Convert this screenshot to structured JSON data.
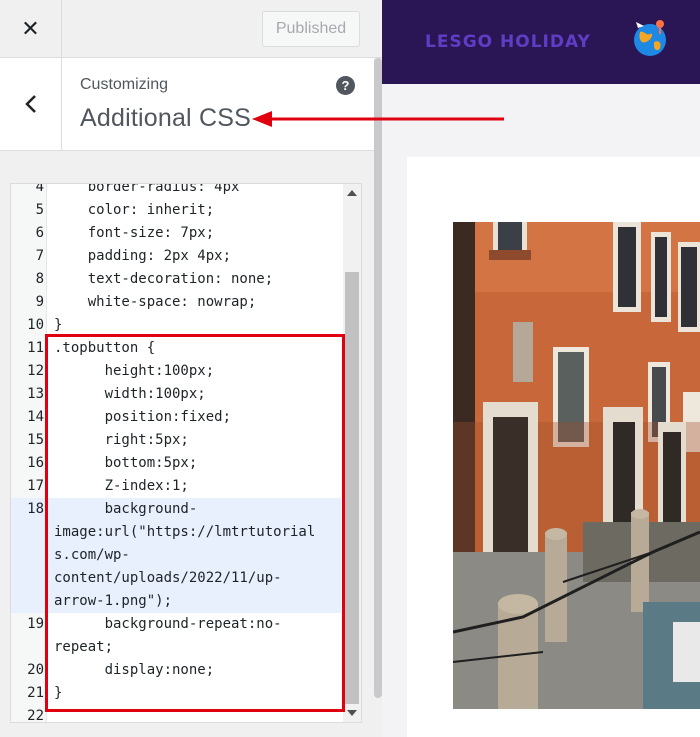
{
  "topbar": {
    "close_glyph": "✕",
    "publish_label": "Published"
  },
  "section": {
    "customizing_label": "Customizing",
    "title": "Additional CSS",
    "help_glyph": "?"
  },
  "editor": {
    "lines": [
      {
        "n": "4",
        "text": "    border-radius: 4px"
      },
      {
        "n": "5",
        "text": "    color: inherit;"
      },
      {
        "n": "6",
        "text": "    font-size: 7px;"
      },
      {
        "n": "7",
        "text": "    padding: 2px 4px;"
      },
      {
        "n": "8",
        "text": "    text-decoration: none;"
      },
      {
        "n": "9",
        "text": "    white-space: nowrap;"
      },
      {
        "n": "10",
        "text": "}"
      },
      {
        "n": "11",
        "text": ".topbutton {"
      },
      {
        "n": "12",
        "text": "      height:100px;"
      },
      {
        "n": "13",
        "text": "      width:100px;"
      },
      {
        "n": "14",
        "text": "      position:fixed;"
      },
      {
        "n": "15",
        "text": "      right:5px;"
      },
      {
        "n": "16",
        "text": "      bottom:5px;"
      },
      {
        "n": "17",
        "text": "      Z-index:1;"
      },
      {
        "n": "18",
        "text": "      background-",
        "cont": [
          "image:url(\"https://lmtrtutorial",
          "s.com/wp-",
          "content/uploads/2022/11/up-",
          "arrow-1.png\");"
        ]
      },
      {
        "n": "19",
        "text": "      background-repeat:no-",
        "cont": [
          "repeat;"
        ]
      },
      {
        "n": "20",
        "text": "      display:none;"
      },
      {
        "n": "21",
        "text": "}"
      },
      {
        "n": "22",
        "text": ""
      }
    ]
  },
  "preview": {
    "site_name": "LESGO HOLIDAY"
  },
  "colors": {
    "accent_red": "#e1000f",
    "header_bg": "#2b1655",
    "logo_text": "#5f3dc4"
  }
}
